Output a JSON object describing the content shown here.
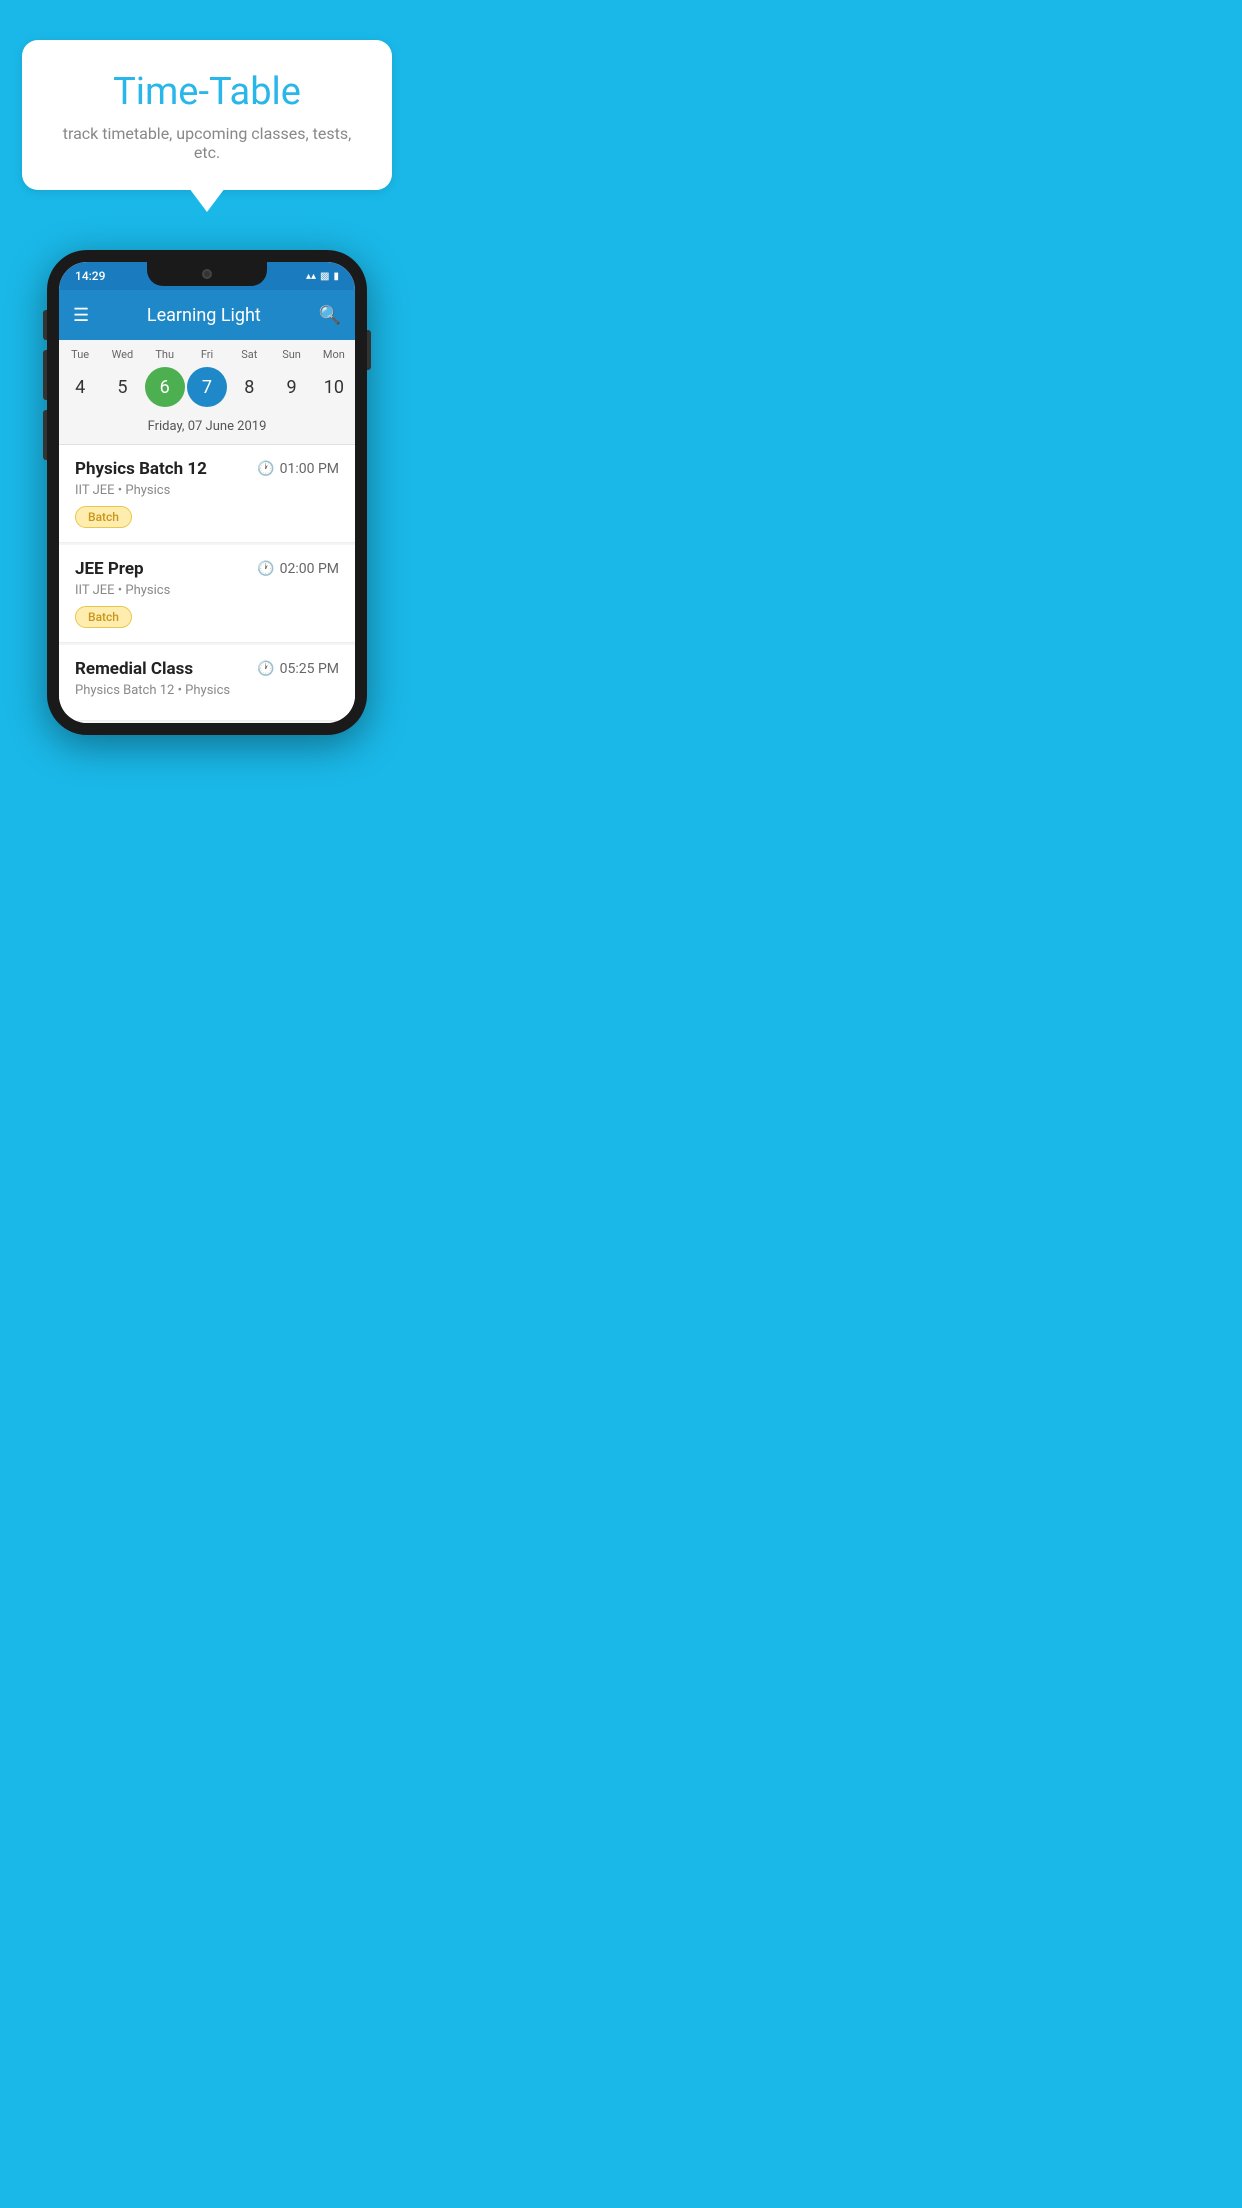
{
  "background_color": "#1ab8e8",
  "bubble": {
    "title": "Time-Table",
    "subtitle": "track timetable, upcoming classes, tests, etc."
  },
  "phone": {
    "status_bar": {
      "time": "14:29"
    },
    "app_bar": {
      "title": "Learning Light"
    },
    "calendar": {
      "days": [
        {
          "label": "Tue",
          "number": "4",
          "state": "normal"
        },
        {
          "label": "Wed",
          "number": "5",
          "state": "normal"
        },
        {
          "label": "Thu",
          "number": "6",
          "state": "today"
        },
        {
          "label": "Fri",
          "number": "7",
          "state": "selected"
        },
        {
          "label": "Sat",
          "number": "8",
          "state": "normal"
        },
        {
          "label": "Sun",
          "number": "9",
          "state": "normal"
        },
        {
          "label": "Mon",
          "number": "10",
          "state": "normal"
        }
      ],
      "selected_date_label": "Friday, 07 June 2019"
    },
    "schedule": [
      {
        "title": "Physics Batch 12",
        "time": "01:00 PM",
        "subtitle": "IIT JEE • Physics",
        "badge": "Batch"
      },
      {
        "title": "JEE Prep",
        "time": "02:00 PM",
        "subtitle": "IIT JEE • Physics",
        "badge": "Batch"
      },
      {
        "title": "Remedial Class",
        "time": "05:25 PM",
        "subtitle": "Physics Batch 12 • Physics",
        "badge": null
      }
    ]
  }
}
